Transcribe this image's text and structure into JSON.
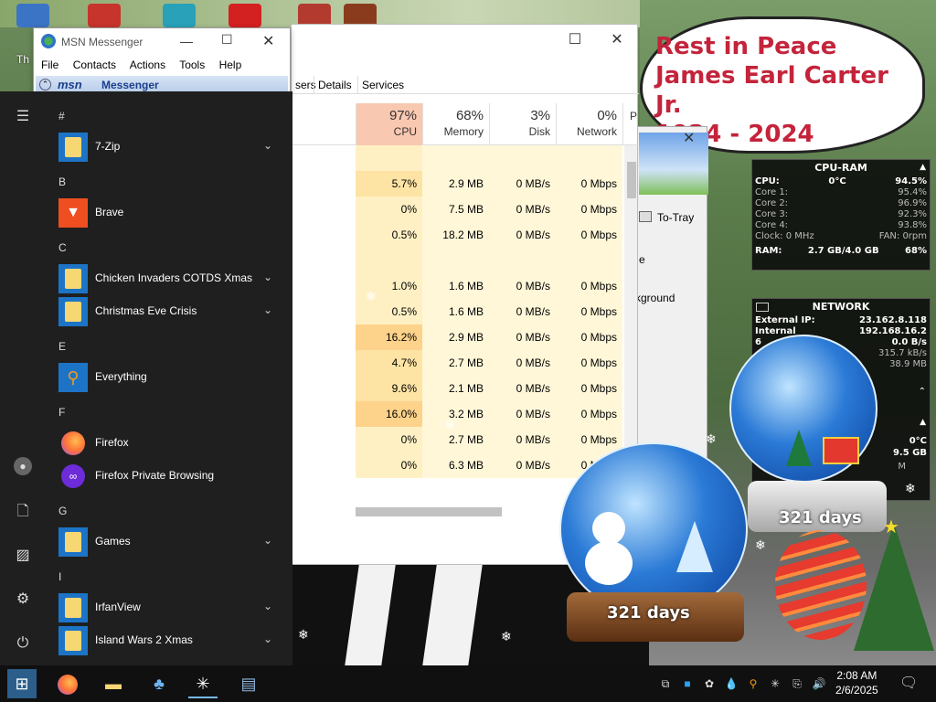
{
  "desktop": {
    "partial_icon_label": "Th"
  },
  "memorial": {
    "line1": "Rest in Peace",
    "line2": "James Earl Carter Jr.",
    "line3": "1924 - 2024"
  },
  "msn": {
    "title": "MSN Messenger",
    "menu": [
      "File",
      "Contacts",
      "Actions",
      "Tools",
      "Help"
    ],
    "brand": "msn",
    "brand_suffix": "Messenger"
  },
  "task_manager": {
    "tabs": [
      "sers",
      "Details",
      "Services"
    ],
    "headers": [
      {
        "pct": "97%",
        "label": "CPU"
      },
      {
        "pct": "68%",
        "label": "Memory"
      },
      {
        "pct": "3%",
        "label": "Disk"
      },
      {
        "pct": "0%",
        "label": "Network"
      },
      {
        "pct": "",
        "label": "P"
      }
    ],
    "rows": [
      {
        "cpu": "",
        "mem": "",
        "disk": "",
        "net": ""
      },
      {
        "cpu": "5.7%",
        "mem": "2.9 MB",
        "disk": "0 MB/s",
        "net": "0 Mbps"
      },
      {
        "cpu": "0%",
        "mem": "7.5 MB",
        "disk": "0 MB/s",
        "net": "0 Mbps"
      },
      {
        "cpu": "0.5%",
        "mem": "18.2 MB",
        "disk": "0 MB/s",
        "net": "0 Mbps"
      },
      {
        "cpu": "",
        "mem": "",
        "disk": "",
        "net": ""
      },
      {
        "cpu": "1.0%",
        "mem": "1.6 MB",
        "disk": "0 MB/s",
        "net": "0 Mbps"
      },
      {
        "cpu": "0.5%",
        "mem": "1.6 MB",
        "disk": "0 MB/s",
        "net": "0 Mbps"
      },
      {
        "cpu": "16.2%",
        "mem": "2.9 MB",
        "disk": "0 MB/s",
        "net": "0 Mbps"
      },
      {
        "cpu": "4.7%",
        "mem": "2.7 MB",
        "disk": "0 MB/s",
        "net": "0 Mbps"
      },
      {
        "cpu": "9.6%",
        "mem": "2.1 MB",
        "disk": "0 MB/s",
        "net": "0 Mbps"
      },
      {
        "cpu": "16.0%",
        "mem": "3.2 MB",
        "disk": "0 MB/s",
        "net": "0 Mbps"
      },
      {
        "cpu": "0%",
        "mem": "2.7 MB",
        "disk": "0 MB/s",
        "net": "0 Mbps"
      },
      {
        "cpu": "0%",
        "mem": "6.3 MB",
        "disk": "0 MB/s",
        "net": "0 Mbps"
      }
    ]
  },
  "background_dialog": {
    "tray_label": "To-Tray",
    "partial_text_1": "e",
    "partial_text_2": "kground"
  },
  "start_menu": {
    "groups": [
      {
        "letter": "#",
        "apps": [
          {
            "name": "7-Zip",
            "expandable": true,
            "icon": "folder-icon"
          }
        ]
      },
      {
        "letter": "B",
        "apps": [
          {
            "name": "Brave",
            "expandable": false,
            "icon": "brave-icon"
          }
        ]
      },
      {
        "letter": "C",
        "apps": [
          {
            "name": "Chicken Invaders COTDS Xmas",
            "expandable": true,
            "icon": "folder-icon"
          },
          {
            "name": "Christmas Eve Crisis",
            "expandable": true,
            "icon": "folder-icon"
          }
        ]
      },
      {
        "letter": "E",
        "apps": [
          {
            "name": "Everything",
            "expandable": false,
            "icon": "magnifier-icon"
          }
        ]
      },
      {
        "letter": "F",
        "apps": [
          {
            "name": "Firefox",
            "expandable": false,
            "icon": "firefox-icon"
          },
          {
            "name": "Firefox Private Browsing",
            "expandable": false,
            "icon": "firefox-private-icon"
          }
        ]
      },
      {
        "letter": "G",
        "apps": [
          {
            "name": "Games",
            "expandable": true,
            "icon": "folder-icon"
          }
        ]
      },
      {
        "letter": "I",
        "apps": [
          {
            "name": "IrfanView",
            "expandable": true,
            "icon": "folder-icon"
          },
          {
            "name": "Island Wars 2 Xmas",
            "expandable": true,
            "icon": "folder-icon"
          }
        ]
      }
    ],
    "rail_icons": [
      "hamburger-icon",
      "user-icon",
      "documents-icon",
      "pictures-icon",
      "settings-icon",
      "power-icon"
    ]
  },
  "cpu_gadget": {
    "title": "CPU-RAM",
    "cpu_label": "CPU:",
    "cpu_temp": "0°C",
    "cpu_pct": "94.5%",
    "cores": [
      {
        "label": "Core 1:",
        "value": "95.4%"
      },
      {
        "label": "Core 2:",
        "value": "96.9%"
      },
      {
        "label": "Core 3:",
        "value": "92.3%"
      },
      {
        "label": "Core 4:",
        "value": "93.8%"
      }
    ],
    "clock": "Clock: 0 MHz",
    "fan": "FAN: 0rpm",
    "ram_label": "RAM:",
    "ram_value": "2.7 GB/4.0 GB",
    "ram_pct": "68%"
  },
  "network_gadget": {
    "title": "NETWORK",
    "external_label": "External IP:",
    "external_ip": "23.162.8.118",
    "internal_label": "Internal",
    "internal_ip": "192.168.16.2",
    "partial_label": "6",
    "rate1": "0.0 B/s",
    "rate2": "315.7 kB/s",
    "rate3": "38.9 MB",
    "temp": "0°C",
    "size": "9.5 GB",
    "partial_m": "M"
  },
  "snow_globes": {
    "left_days": "321 days",
    "right_days": "321 days"
  },
  "taskbar": {
    "pinned": [
      "start-icon",
      "firefox-icon",
      "file-explorer-icon",
      "msn-icon",
      "snowflake-icon",
      "control-panel-icon"
    ],
    "time": "2:08 AM",
    "date": "2/6/2025"
  },
  "colors": {
    "memorial_text": "#c4243b",
    "cpu_header": "#f9c8b0",
    "start_bg": "#1f1f1f",
    "tile_blue": "#1d74c6"
  }
}
